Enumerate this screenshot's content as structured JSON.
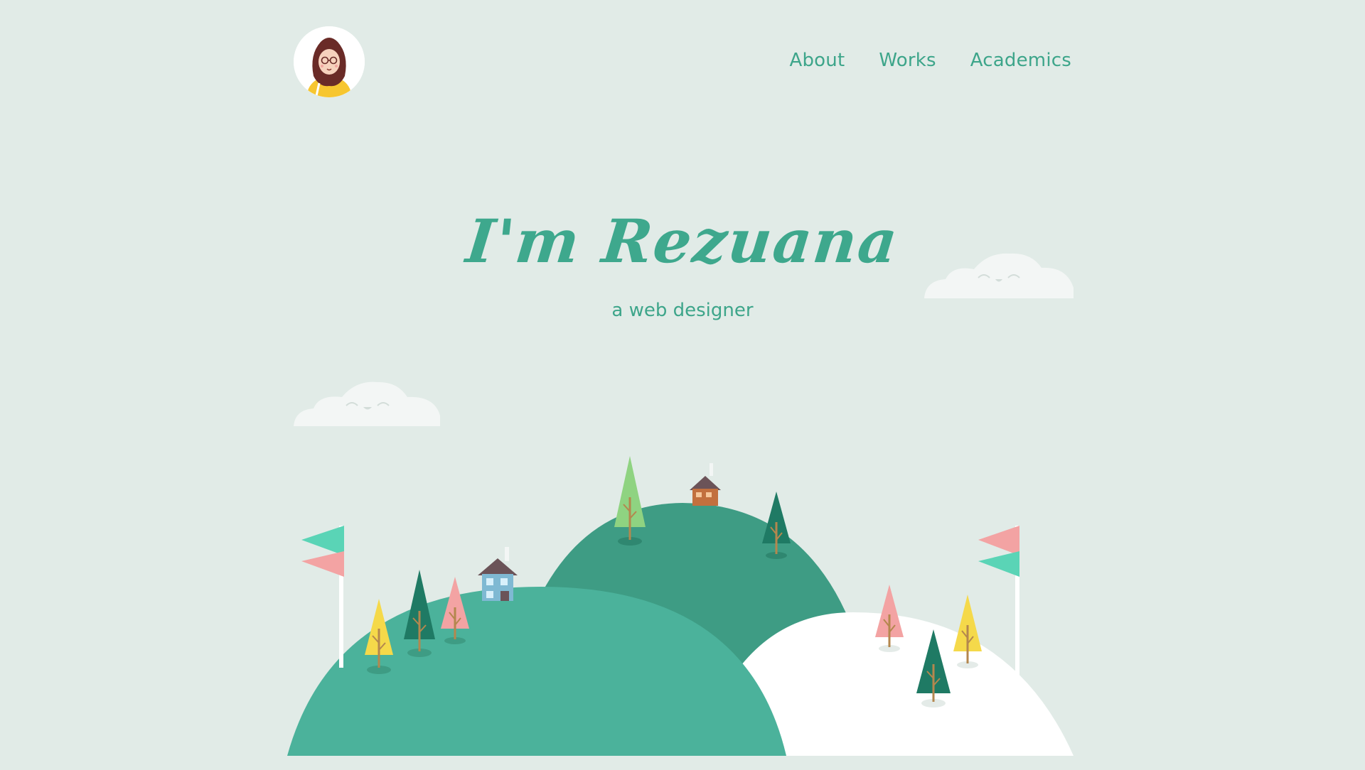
{
  "header": {
    "avatar_icon": "avatar-girl-hijab-icon",
    "nav": [
      {
        "label": "About"
      },
      {
        "label": "Works"
      },
      {
        "label": "Academics"
      }
    ]
  },
  "hero": {
    "title": "I'm Rezuana",
    "subtitle": "a web designer"
  },
  "colors": {
    "background": "#e1ebe7",
    "accent": "#3da58a",
    "hill_dark": "#3e9c84",
    "hill_light": "#4bb29b",
    "hill_white": "#ffffff",
    "cloud": "#f3f6f5"
  }
}
